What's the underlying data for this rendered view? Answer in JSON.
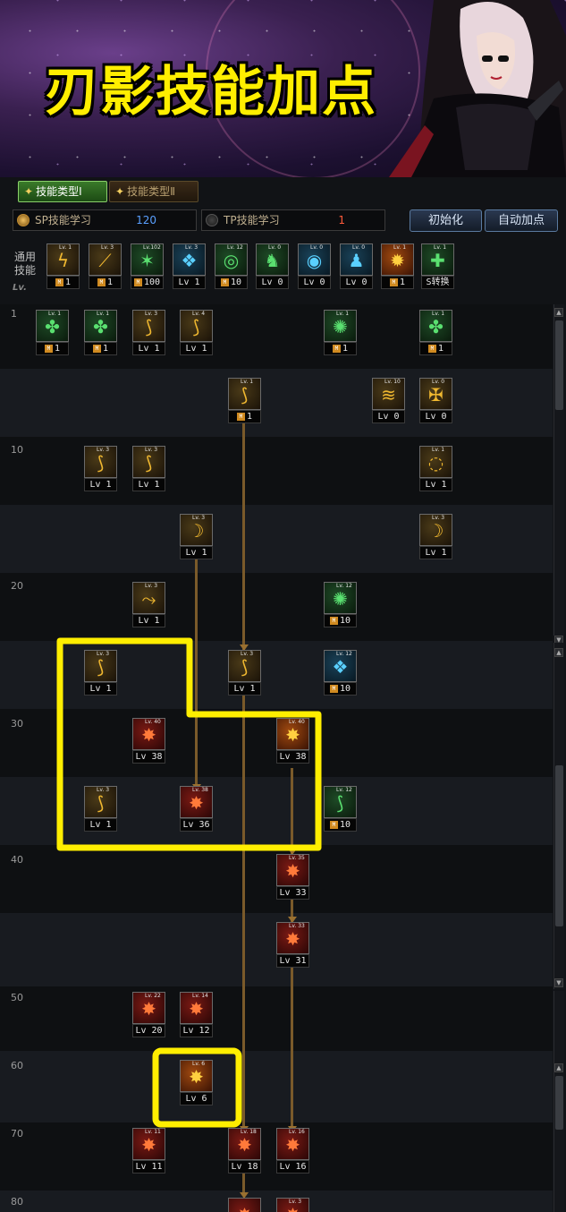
{
  "banner": {
    "title": "刃影技能加点"
  },
  "tabs": [
    {
      "label": "技能类型Ⅰ",
      "active": true
    },
    {
      "label": "技能类型Ⅱ",
      "active": false
    }
  ],
  "points": {
    "sp": {
      "label": "SP技能学习",
      "value": "120"
    },
    "tp": {
      "label": "TP技能学习",
      "value": "1"
    }
  },
  "buttons": {
    "reset": "初始化",
    "auto": "自动加点"
  },
  "common": {
    "label": "通用技能",
    "lv_header": "Lv."
  },
  "colors": {
    "highlight": "#ffee00",
    "connector": "#7a5a2a",
    "sp_value": "#5aa0ff",
    "tp_value": "#ff5a3a"
  },
  "levels": [
    "1",
    "10",
    "20",
    "30",
    "40",
    "50",
    "60",
    "70",
    "80"
  ],
  "common_skills": [
    {
      "icon": "dodge-icon",
      "req": "Lv. 1",
      "level": "1",
      "mastery": true,
      "tone": "gold"
    },
    {
      "icon": "slash-icon",
      "req": "Lv. 3",
      "level": "1",
      "mastery": true,
      "tone": "gold"
    },
    {
      "icon": "strike-icon",
      "req": "Lv.102",
      "level": "100",
      "mastery": true,
      "tone": "green"
    },
    {
      "icon": "wing-icon",
      "req": "Lv. 3",
      "level": "Lv 1",
      "mastery": false,
      "tone": "cyan"
    },
    {
      "icon": "target-icon",
      "req": "Lv. 12",
      "level": "10",
      "mastery": true,
      "tone": "green"
    },
    {
      "icon": "figure-icon",
      "req": "Lv. 0",
      "level": "Lv 0",
      "mastery": false,
      "tone": "green"
    },
    {
      "icon": "eye-icon",
      "req": "Lv. 0",
      "level": "Lv 0",
      "mastery": false,
      "tone": "cyan"
    },
    {
      "icon": "body-icon",
      "req": "Lv. 0",
      "level": "Lv 0",
      "mastery": false,
      "tone": "cyan"
    },
    {
      "icon": "burst-icon",
      "req": "Lv. 1",
      "level": "1",
      "mastery": true,
      "tone": "fire"
    },
    {
      "icon": "physical-icon",
      "req": "Lv. 1",
      "level": "S转换",
      "mastery": false,
      "tone": "green"
    }
  ],
  "tree_skills": [
    {
      "icon": "tree-skill-icon",
      "req": "Lv. 1",
      "level": "1",
      "mastery": true,
      "tone": "green"
    },
    {
      "icon": "tree-skill-icon",
      "req": "Lv. 1",
      "level": "1",
      "mastery": true,
      "tone": "green"
    },
    {
      "icon": "blade-icon",
      "req": "Lv. 3",
      "level": "Lv 1",
      "mastery": false,
      "tone": "gold"
    },
    {
      "icon": "blade-icon",
      "req": "Lv. 4",
      "level": "Lv 1",
      "mastery": false,
      "tone": "gold"
    },
    {
      "icon": "swirl-icon",
      "req": "Lv. 1",
      "level": "1",
      "mastery": true,
      "tone": "green"
    },
    {
      "icon": "tree-skill-icon",
      "req": "Lv. 1",
      "level": "1",
      "mastery": true,
      "tone": "green"
    },
    {
      "icon": "blade-icon",
      "req": "Lv. 1",
      "level": "1",
      "mastery": true,
      "tone": "gold"
    },
    {
      "icon": "wave-icon",
      "req": "Lv. 10",
      "level": "Lv 0",
      "mastery": false,
      "tone": "gold"
    },
    {
      "icon": "shield-icon",
      "req": "Lv. 0",
      "level": "Lv 0",
      "mastery": false,
      "tone": "gold"
    },
    {
      "icon": "blade-icon",
      "req": "Lv. 3",
      "level": "Lv 1",
      "mastery": false,
      "tone": "gold"
    },
    {
      "icon": "blade-icon",
      "req": "Lv. 3",
      "level": "Lv 1",
      "mastery": false,
      "tone": "gold"
    },
    {
      "icon": "ring-icon",
      "req": "Lv. 1",
      "level": "Lv 1",
      "mastery": false,
      "tone": "gold"
    },
    {
      "icon": "crescent-icon",
      "req": "Lv. 3",
      "level": "Lv 1",
      "mastery": false,
      "tone": "gold"
    },
    {
      "icon": "crescent-icon",
      "req": "Lv. 3",
      "level": "Lv 1",
      "mastery": false,
      "tone": "gold"
    },
    {
      "icon": "kick-icon",
      "req": "Lv. 3",
      "level": "Lv 1",
      "mastery": false,
      "tone": "gold"
    },
    {
      "icon": "swirl-icon",
      "req": "Lv. 12",
      "level": "10",
      "mastery": true,
      "tone": "green"
    },
    {
      "icon": "blade-icon",
      "req": "Lv. 3",
      "level": "Lv 1",
      "mastery": false,
      "tone": "gold"
    },
    {
      "icon": "blade-icon",
      "req": "Lv. 3",
      "level": "Lv 1",
      "mastery": false,
      "tone": "gold"
    },
    {
      "icon": "wing-icon",
      "req": "Lv. 12",
      "level": "10",
      "mastery": true,
      "tone": "cyan"
    },
    {
      "icon": "flame-icon",
      "req": "Lv. 40",
      "level": "Lv 38",
      "mastery": false,
      "tone": "red"
    },
    {
      "icon": "flame-icon",
      "req": "Lv. 40",
      "level": "Lv 38",
      "mastery": false,
      "tone": "fire"
    },
    {
      "icon": "blade-icon",
      "req": "Lv. 3",
      "level": "Lv 1",
      "mastery": false,
      "tone": "gold"
    },
    {
      "icon": "flame-icon",
      "req": "Lv. 38",
      "level": "Lv 36",
      "mastery": false,
      "tone": "red"
    },
    {
      "icon": "blade-icon",
      "req": "Lv. 12",
      "level": "10",
      "mastery": true,
      "tone": "green"
    },
    {
      "icon": "flame-icon",
      "req": "Lv. 35",
      "level": "Lv 33",
      "mastery": false,
      "tone": "red"
    },
    {
      "icon": "flame-icon",
      "req": "Lv. 33",
      "level": "Lv 31",
      "mastery": false,
      "tone": "red"
    },
    {
      "icon": "flame-icon",
      "req": "Lv. 22",
      "level": "Lv 20",
      "mastery": false,
      "tone": "red"
    },
    {
      "icon": "flame-icon",
      "req": "Lv. 14",
      "level": "Lv 12",
      "mastery": false,
      "tone": "red"
    },
    {
      "icon": "flame-icon",
      "req": "Lv. 6",
      "level": "Lv 6",
      "mastery": false,
      "tone": "fire"
    },
    {
      "icon": "flame-icon",
      "req": "Lv. 11",
      "level": "Lv 11",
      "mastery": false,
      "tone": "red"
    },
    {
      "icon": "flame-icon",
      "req": "Lv. 18",
      "level": "Lv 18",
      "mastery": false,
      "tone": "red"
    },
    {
      "icon": "flame-icon",
      "req": "Lv. 16",
      "level": "Lv 16",
      "mastery": false,
      "tone": "red"
    },
    {
      "icon": "flame-icon",
      "req": "",
      "level": "",
      "mastery": false,
      "tone": "red"
    },
    {
      "icon": "flame-icon",
      "req": "Lv. 3",
      "level": "",
      "mastery": false,
      "tone": "red"
    }
  ]
}
